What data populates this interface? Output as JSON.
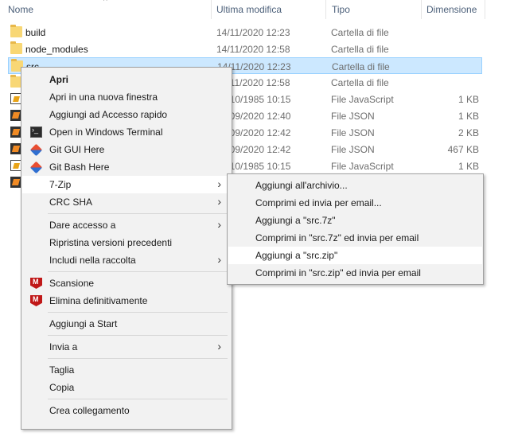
{
  "header": {
    "name": "Nome",
    "modified": "Ultima modifica",
    "type": "Tipo",
    "size": "Dimensione"
  },
  "files": [
    {
      "name": "build",
      "date": "14/11/2020 12:23",
      "type": "Cartella di file",
      "size": "",
      "icon": "folder-icon"
    },
    {
      "name": "node_modules",
      "date": "14/11/2020 12:58",
      "type": "Cartella di file",
      "size": "",
      "icon": "folder-icon"
    },
    {
      "name": "src",
      "date": "14/11/2020 12:23",
      "type": "Cartella di file",
      "size": "",
      "icon": "folder-icon",
      "selected": true
    },
    {
      "name": "",
      "date": "14/11/2020 12:58",
      "type": "Cartella di file",
      "size": "",
      "icon": "folder-icon"
    },
    {
      "name": "",
      "date": "26/10/1985 10:15",
      "type": "File JavaScript",
      "size": "1 KB",
      "icon": "js-file-icon"
    },
    {
      "name": "",
      "date": "14/09/2020 12:40",
      "type": "File JSON",
      "size": "1 KB",
      "icon": "json-file-icon"
    },
    {
      "name": "",
      "date": "14/09/2020 12:42",
      "type": "File JSON",
      "size": "2 KB",
      "icon": "json-file-icon"
    },
    {
      "name": "",
      "date": "14/09/2020 12:42",
      "type": "File JSON",
      "size": "467 KB",
      "icon": "json-file-icon"
    },
    {
      "name": "",
      "date": "26/10/1985 10:15",
      "type": "File JavaScript",
      "size": "1 KB",
      "icon": "js-file-icon"
    },
    {
      "name": "",
      "date": "",
      "type": "",
      "size": "",
      "icon": "json-file-icon"
    }
  ],
  "context_menu": {
    "open": "Apri",
    "open_new_window": "Apri in una nuova finestra",
    "add_quick_access": "Aggiungi ad Accesso rapido",
    "open_terminal": "Open in Windows Terminal",
    "git_gui": "Git GUI Here",
    "git_bash": "Git Bash Here",
    "seven_zip": "7-Zip",
    "crc_sha": "CRC SHA",
    "give_access": "Dare accesso a",
    "restore_versions": "Ripristina versioni precedenti",
    "include_library": "Includi nella raccolta",
    "scan": "Scansione",
    "delete_permanently": "Elimina definitivamente",
    "add_to_start": "Aggiungi a Start",
    "send_to": "Invia a",
    "cut": "Taglia",
    "copy": "Copia",
    "create_shortcut": "Crea collegamento"
  },
  "submenu_7zip": {
    "add_archive": "Aggiungi all'archivio...",
    "compress_email": "Comprimi ed invia per email...",
    "add_7z": "Aggiungi a \"src.7z\"",
    "compress_7z_email": "Comprimi in \"src.7z\" ed invia per email",
    "add_zip": "Aggiungi a \"src.zip\"",
    "compress_zip_email": "Comprimi in \"src.zip\" ed invia per email"
  }
}
